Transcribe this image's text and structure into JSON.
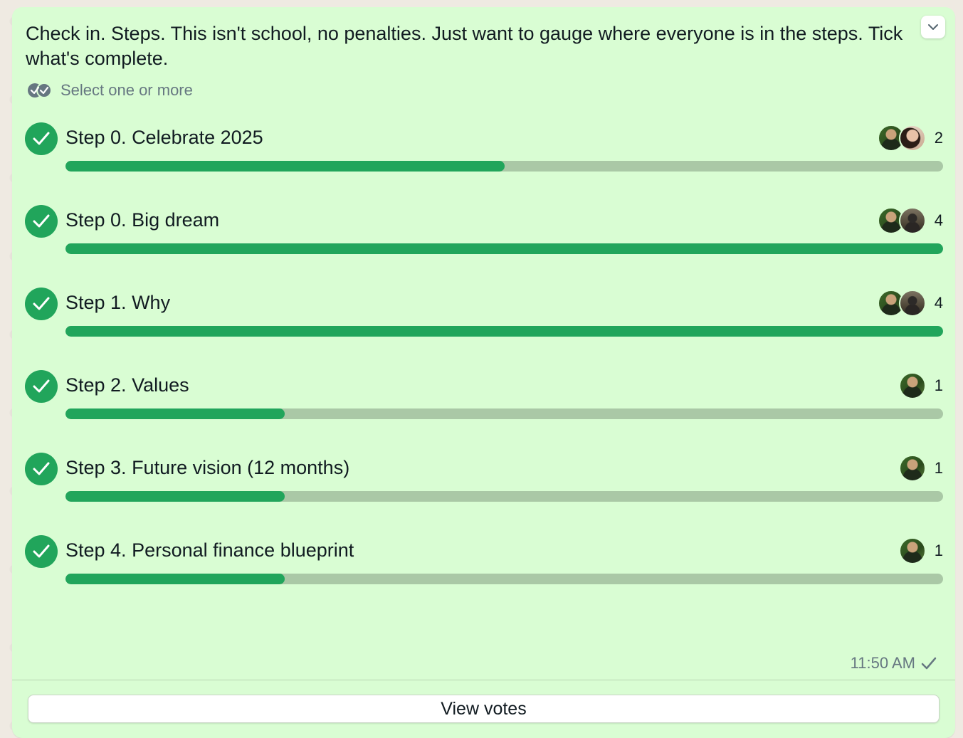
{
  "poll": {
    "question": "Check in. Steps. This isn't school, no penalties. Just want to gauge where everyone is in the steps. Tick what's complete.",
    "select_hint": "Select one or more",
    "options": [
      {
        "label": "Step 0. Celebrate 2025",
        "votes": "2",
        "progress": 0.5,
        "checked": true,
        "voters": [
          "avatar-a",
          "avatar-b"
        ]
      },
      {
        "label": "Step 0. Big dream",
        "votes": "4",
        "progress": 1.0,
        "checked": true,
        "voters": [
          "avatar-a",
          "avatar-c"
        ]
      },
      {
        "label": "Step 1. Why",
        "votes": "4",
        "progress": 1.0,
        "checked": true,
        "voters": [
          "avatar-a",
          "avatar-c"
        ]
      },
      {
        "label": "Step 2. Values",
        "votes": "1",
        "progress": 0.25,
        "checked": true,
        "voters": [
          "avatar-a"
        ]
      },
      {
        "label": "Step 3. Future vision (12 months)",
        "votes": "1",
        "progress": 0.25,
        "checked": true,
        "voters": [
          "avatar-a"
        ]
      },
      {
        "label": "Step 4. Personal finance blueprint",
        "votes": "1",
        "progress": 0.25,
        "checked": true,
        "voters": [
          "avatar-a"
        ]
      }
    ],
    "timestamp": "11:50 AM",
    "view_votes_label": "View votes"
  },
  "colors": {
    "bubble": "#d9fdd3",
    "accent": "#21a55b",
    "bar_track": "#aac8a6",
    "meta_text": "#667781"
  },
  "icons": {
    "menu": "chevron-down-icon",
    "select_hint": "double-check-icon",
    "option_check": "check-circle-icon",
    "sent_status": "single-check-icon"
  }
}
